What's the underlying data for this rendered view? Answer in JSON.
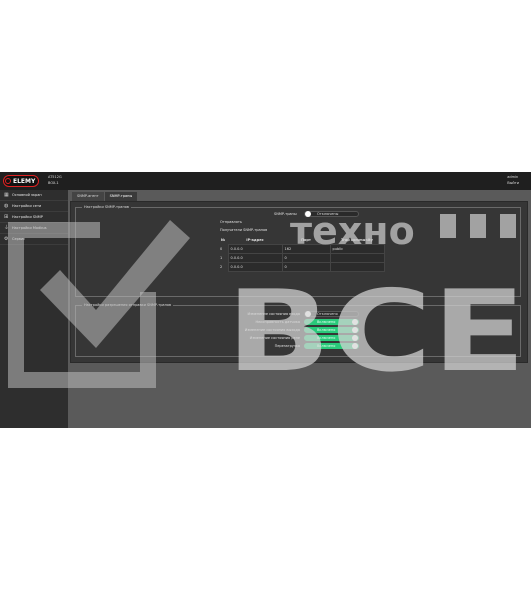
{
  "header": {
    "brand": "ELEMY",
    "device_model": "AT512G",
    "device_id": "BOX-1",
    "user_name": "admin",
    "logout_label": "Выйти"
  },
  "sidebar": {
    "items": [
      {
        "label": "Основной экран",
        "icon": "gauge-icon"
      },
      {
        "label": "Настройки сети",
        "icon": "globe-icon"
      },
      {
        "label": "Настройки SNMP",
        "icon": "network-icon"
      },
      {
        "label": "Настройки Modbus",
        "icon": "plug-icon"
      },
      {
        "label": "Сервис",
        "icon": "gear-icon"
      }
    ]
  },
  "tabs": [
    {
      "label": "SNMP-агент",
      "active": false
    },
    {
      "label": "SNMP-трапы",
      "active": true
    }
  ],
  "traps_section": {
    "legend": "Настройки SNMP-трапов",
    "enable_label": "SNMP-трапы",
    "enable_state": "Отключены",
    "send_label": "Отправлять",
    "receivers_label": "Получатели SNMP-трапов",
    "columns": [
      "№",
      "IP-адрес",
      "Порт",
      "Trap community"
    ],
    "rows": [
      {
        "num": "0",
        "ip": "0.0.0.0",
        "port": "162",
        "community": "public"
      },
      {
        "num": "1",
        "ip": "0.0.0.0",
        "port": "0",
        "community": ""
      },
      {
        "num": "2",
        "ip": "0.0.0.0",
        "port": "0",
        "community": ""
      }
    ]
  },
  "events_section": {
    "legend": "Настройки разрешения отправки SNMP-трапов",
    "events": [
      {
        "label": "Изменение состояния входа",
        "state": "Отключено",
        "on": false
      },
      {
        "label": "Неисправность датчика",
        "state": "Включено",
        "on": true
      },
      {
        "label": "Изменение состояния выхода",
        "state": "Включено",
        "on": true
      },
      {
        "label": "Изменение состояния реле",
        "state": "Включено",
        "on": true
      },
      {
        "label": "Перезагрузка",
        "state": "Включено",
        "on": true
      }
    ]
  },
  "watermark": {
    "word_top": "техно",
    "word_big": "ВСЕ"
  },
  "colors": {
    "accent_green": "#29c97a",
    "brand_red": "#d22222",
    "header_bg": "#1f1f1f",
    "sidebar_bg": "#2e2e2e"
  }
}
